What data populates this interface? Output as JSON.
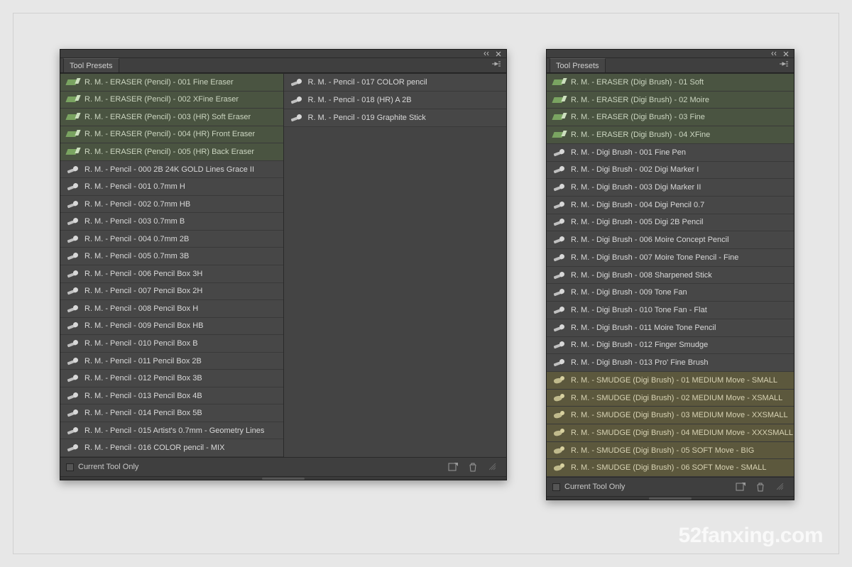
{
  "watermark": "52fanxing.com",
  "panels": [
    {
      "title": "Tool Presets",
      "footer_label": "Current Tool Only",
      "columns": [
        [
          {
            "t": "eraser",
            "l": "R. M. - ERASER (Pencil) - 001 Fine Eraser"
          },
          {
            "t": "eraser",
            "l": "R. M. - ERASER (Pencil) - 002 XFine Eraser"
          },
          {
            "t": "eraser",
            "l": "R. M. - ERASER (Pencil) - 003 (HR) Soft Eraser"
          },
          {
            "t": "eraser",
            "l": "R. M. - ERASER (Pencil) - 004 (HR) Front Eraser"
          },
          {
            "t": "eraser",
            "l": "R. M. - ERASER (Pencil) - 005 (HR) Back Eraser"
          },
          {
            "t": "brush",
            "l": "R. M. - Pencil - 000 2B 24K GOLD Lines Grace II"
          },
          {
            "t": "brush",
            "l": "R. M. - Pencil - 001 0.7mm H"
          },
          {
            "t": "brush",
            "l": "R. M. - Pencil - 002 0.7mm HB"
          },
          {
            "t": "brush",
            "l": "R. M. - Pencil - 003 0.7mm B"
          },
          {
            "t": "brush",
            "l": "R. M. - Pencil - 004 0.7mm 2B"
          },
          {
            "t": "brush",
            "l": "R. M. - Pencil - 005 0.7mm 3B"
          },
          {
            "t": "brush",
            "l": "R. M. - Pencil - 006 Pencil Box 3H"
          },
          {
            "t": "brush",
            "l": "R. M. - Pencil - 007 Pencil Box 2H"
          },
          {
            "t": "brush",
            "l": "R. M. - Pencil - 008 Pencil Box H"
          },
          {
            "t": "brush",
            "l": "R. M. - Pencil - 009 Pencil Box HB"
          },
          {
            "t": "brush",
            "l": "R. M. - Pencil - 010 Pencil Box B"
          },
          {
            "t": "brush",
            "l": "R. M. - Pencil - 011 Pencil Box 2B"
          },
          {
            "t": "brush",
            "l": "R. M. - Pencil - 012 Pencil Box 3B"
          },
          {
            "t": "brush",
            "l": "R. M. - Pencil - 013 Pencil Box 4B"
          },
          {
            "t": "brush",
            "l": "R. M. - Pencil - 014 Pencil Box 5B"
          },
          {
            "t": "brush",
            "l": "R. M. - Pencil - 015 Artist's 0.7mm - Geometry Lines"
          },
          {
            "t": "brush",
            "l": "R. M. - Pencil - 016 COLOR pencil - MIX"
          }
        ],
        [
          {
            "t": "brush",
            "l": "R. M. - Pencil - 017 COLOR pencil"
          },
          {
            "t": "brush",
            "l": "R. M. - Pencil - 018 (HR) A 2B"
          },
          {
            "t": "brush",
            "l": "R. M. - Pencil - 019 Graphite Stick"
          }
        ]
      ]
    },
    {
      "title": "Tool Presets",
      "footer_label": "Current Tool Only",
      "columns": [
        [
          {
            "t": "eraser",
            "l": "R. M. - ERASER (Digi Brush) - 01 Soft"
          },
          {
            "t": "eraser",
            "l": "R. M. - ERASER (Digi Brush) - 02 Moire"
          },
          {
            "t": "eraser",
            "l": "R. M. - ERASER (Digi Brush) - 03 Fine"
          },
          {
            "t": "eraser",
            "l": "R. M. - ERASER (Digi Brush) - 04 XFine"
          },
          {
            "t": "brush",
            "l": "R. M. - Digi Brush - 001 Fine Pen"
          },
          {
            "t": "brush",
            "l": "R. M. - Digi Brush - 002 Digi Marker I"
          },
          {
            "t": "brush",
            "l": "R. M. - Digi Brush - 003 Digi Marker II"
          },
          {
            "t": "brush",
            "l": "R. M. - Digi Brush - 004 Digi Pencil 0.7"
          },
          {
            "t": "brush",
            "l": "R. M. - Digi Brush - 005 Digi 2B Pencil"
          },
          {
            "t": "brush",
            "l": "R. M. - Digi Brush - 006 Moire Concept Pencil"
          },
          {
            "t": "brush",
            "l": "R. M. - Digi Brush - 007 Moire Tone Pencil - Fine"
          },
          {
            "t": "brush",
            "l": "R. M. - Digi Brush - 008 Sharpened Stick"
          },
          {
            "t": "brush",
            "l": "R. M. - Digi Brush - 009 Tone Fan"
          },
          {
            "t": "brush",
            "l": "R. M. - Digi Brush - 010 Tone Fan - Flat"
          },
          {
            "t": "brush",
            "l": "R. M. - Digi Brush - 011 Moire Tone Pencil"
          },
          {
            "t": "brush",
            "l": "R. M. - Digi Brush - 012 Finger Smudge"
          },
          {
            "t": "brush",
            "l": "R. M. - Digi Brush - 013 Pro' Fine Brush"
          },
          {
            "t": "smudge",
            "l": "R. M. - SMUDGE (Digi Brush) - 01 MEDIUM Move - SMALL"
          },
          {
            "t": "smudge",
            "l": "R. M. - SMUDGE (Digi Brush) - 02 MEDIUM Move - XSMALL"
          },
          {
            "t": "smudge",
            "l": "R. M. - SMUDGE (Digi Brush) - 03 MEDIUM Move - XXSMALL"
          },
          {
            "t": "smudge",
            "l": "R. M. - SMUDGE (Digi Brush) - 04 MEDIUM Move - XXXSMALL"
          },
          {
            "t": "smudge",
            "l": "R. M. - SMUDGE (Digi Brush) - 05 SOFT Move - BIG"
          },
          {
            "t": "smudge",
            "l": "R. M. - SMUDGE (Digi Brush) - 06 SOFT Move - SMALL"
          }
        ]
      ]
    }
  ]
}
